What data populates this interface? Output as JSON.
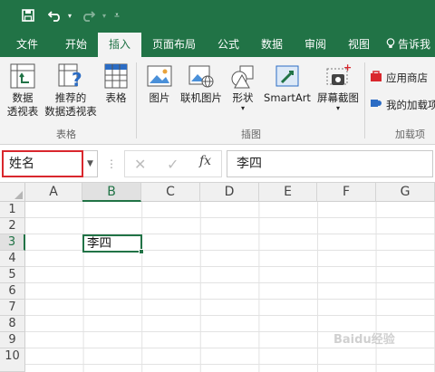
{
  "colors": {
    "brand": "#217346",
    "highlight": "#d9272d"
  },
  "qat": {
    "save_icon": "save-icon",
    "undo_icon": "undo-icon",
    "redo_icon": "redo-icon",
    "customize_icon": "customize-icon"
  },
  "tabs": [
    "文件",
    "开始",
    "插入",
    "页面布局",
    "公式",
    "数据",
    "审阅",
    "视图",
    "告诉我"
  ],
  "active_tab": "插入",
  "ribbon": {
    "tables": {
      "pivot": [
        "数据",
        "透视表"
      ],
      "recommended": [
        "推荐的",
        "数据透视表"
      ],
      "table": "表格",
      "label": "表格"
    },
    "illustrations": {
      "pictures": "图片",
      "online_pictures": "联机图片",
      "shapes": "形状",
      "smartart": "SmartArt",
      "screenshot": "屏幕截图",
      "label": "插图"
    },
    "addins": {
      "store": "应用商店",
      "my_addins": "我的加载项",
      "label": "加载项"
    }
  },
  "formula_bar": {
    "name_box": "姓名",
    "fx": "fx",
    "content": "李四"
  },
  "columns": [
    "A",
    "B",
    "C",
    "D",
    "E",
    "F",
    "G"
  ],
  "selected_column": "B",
  "rows": [
    "1",
    "2",
    "3",
    "4",
    "5",
    "6",
    "7",
    "8",
    "9",
    "10"
  ],
  "selected_row": "3",
  "active_cell": {
    "ref": "B3",
    "value": "李四"
  },
  "watermark": "Baidu经验"
}
